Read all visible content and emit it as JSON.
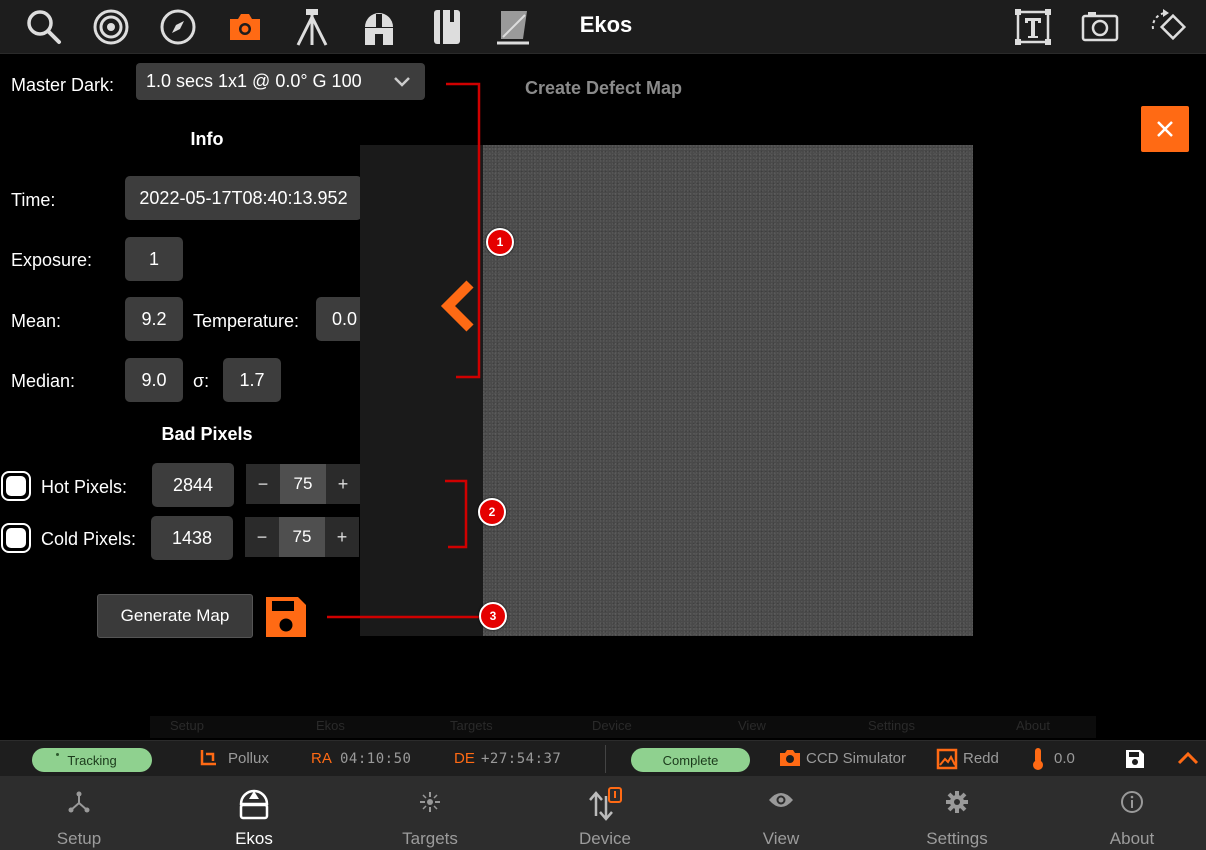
{
  "app": {
    "title": "Ekos"
  },
  "toolbar": {
    "icons": [
      "search-icon",
      "target-icon",
      "compass-icon",
      "camera-icon",
      "tripod-icon",
      "observatory-icon",
      "notebook-icon",
      "filter-icon",
      "text-icon",
      "image-icon",
      "rotate-icon"
    ],
    "accent": "#ff6a14"
  },
  "master_dark": {
    "label": "Master Dark:",
    "value": "1.0 secs 1x1 @ 0.0° G 100"
  },
  "info": {
    "heading": "Info",
    "time_label": "Time:",
    "time_value": "2022-05-17T08:40:13.952",
    "exposure_label": "Exposure:",
    "exposure_value": "1",
    "mean_label": "Mean:",
    "mean_value": "9.2",
    "temperature_label": "Temperature:",
    "temperature_value": "0.0",
    "median_label": "Median:",
    "median_value": "9.0",
    "sigma_label": "σ:",
    "sigma_value": "1.7"
  },
  "bad_pixels": {
    "heading": "Bad Pixels",
    "hot_label": "Hot Pixels:",
    "hot_count": "2844",
    "hot_threshold": "75",
    "cold_label": "Cold Pixels:",
    "cold_count": "1438",
    "cold_threshold": "75",
    "minus": "−",
    "plus": "+"
  },
  "actions": {
    "generate_label": "Generate Map"
  },
  "panel": {
    "title": "Create Defect Map"
  },
  "annotations": [
    "1",
    "2",
    "3"
  ],
  "ghost_nav": [
    "Setup",
    "Ekos",
    "Targets",
    "Device",
    "View",
    "Settings",
    "About"
  ],
  "status": {
    "tracking": "Tracking",
    "target": "Pollux",
    "ra_label": "RA",
    "ra_value": "04:10:50",
    "de_label": "DE",
    "de_value": "+27:54:37",
    "capture_state": "Complete",
    "camera": "CCD Simulator",
    "image_name": "Redd",
    "temperature": "0.0"
  },
  "nav": [
    {
      "label": "Setup"
    },
    {
      "label": "Ekos"
    },
    {
      "label": "Targets"
    },
    {
      "label": "Device"
    },
    {
      "label": "View"
    },
    {
      "label": "Settings"
    },
    {
      "label": "About"
    }
  ]
}
